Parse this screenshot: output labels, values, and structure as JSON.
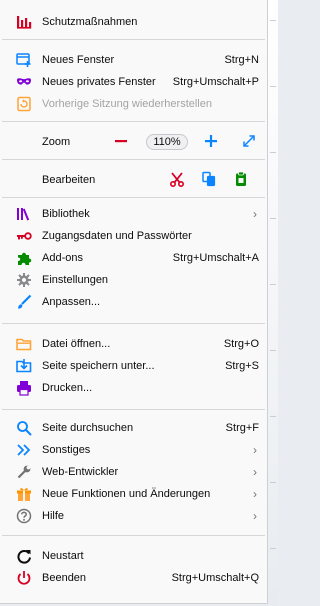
{
  "menu": {
    "protections": {
      "label": "Schutzmaßnahmen",
      "icon": "bar-chart-icon"
    },
    "new_window": {
      "label": "Neues Fenster",
      "shortcut": "Strg+N",
      "icon": "new-window-icon"
    },
    "new_private_window": {
      "label": "Neues privates Fenster",
      "shortcut": "Strg+Umschalt+P",
      "icon": "private-mask-icon"
    },
    "restore_session": {
      "label": "Vorherige Sitzung wiederherstellen",
      "icon": "restore-session-icon"
    },
    "zoom": {
      "label": "Zoom",
      "value": "110%"
    },
    "edit": {
      "label": "Bearbeiten"
    },
    "library": {
      "label": "Bibliothek",
      "icon": "library-icon"
    },
    "logins": {
      "label": "Zugangsdaten und Passwörter",
      "icon": "key-icon"
    },
    "addons": {
      "label": "Add-ons",
      "shortcut": "Strg+Umschalt+A",
      "icon": "puzzle-icon"
    },
    "settings": {
      "label": "Einstellungen",
      "icon": "gear-icon"
    },
    "customize": {
      "label": "Anpassen...",
      "icon": "paintbrush-icon"
    },
    "open_file": {
      "label": "Datei öffnen...",
      "shortcut": "Strg+O",
      "icon": "folder-icon"
    },
    "save_page": {
      "label": "Seite speichern unter...",
      "shortcut": "Strg+S",
      "icon": "save-icon"
    },
    "print": {
      "label": "Drucken...",
      "icon": "printer-icon"
    },
    "find": {
      "label": "Seite durchsuchen",
      "shortcut": "Strg+F",
      "icon": "search-icon"
    },
    "more": {
      "label": "Sonstiges",
      "icon": "double-chevron-icon"
    },
    "web_dev": {
      "label": "Web-Entwickler",
      "icon": "wrench-icon"
    },
    "whats_new": {
      "label": "Neue Funktionen und Änderungen",
      "icon": "gift-icon"
    },
    "help": {
      "label": "Hilfe",
      "icon": "help-icon"
    },
    "restart": {
      "label": "Neustart",
      "icon": "restart-icon"
    },
    "quit": {
      "label": "Beenden",
      "shortcut": "Strg+Umschalt+Q",
      "icon": "power-icon"
    }
  },
  "colors": {
    "accent_blue": "#0a84ff",
    "red": "#d70022",
    "green": "#058b00",
    "purple": "#8000d7",
    "orange": "#ffa436",
    "disabled_text": "#a3a3a5"
  }
}
